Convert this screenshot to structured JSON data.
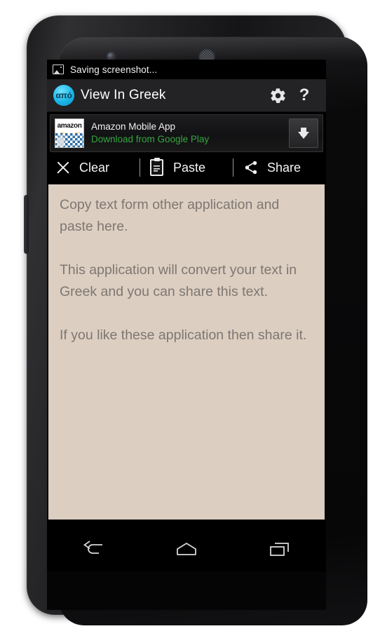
{
  "device": {
    "front_camera": "front-camera",
    "speaker": "earpiece-speaker",
    "volume_rocker": "volume-rocker"
  },
  "status_bar": {
    "icon": "photo-icon",
    "text": "Saving screenshot..."
  },
  "action_bar": {
    "logo_text": "από",
    "logo_icon": "app-logo-icon",
    "title": "View In Greek",
    "settings_icon": "gear-icon",
    "help_icon": "?",
    "background_color": "#232326"
  },
  "ad_banner": {
    "app_icon_word": "amazon",
    "title": "Amazon Mobile App",
    "subtitle": "Download from Google Play",
    "subtitle_color": "#35a63f",
    "download_icon": "download-arrow-icon"
  },
  "toolbar": {
    "buttons": [
      {
        "icon": "close-x-icon",
        "label": "Clear"
      },
      {
        "icon": "clipboard-icon",
        "label": "Paste"
      },
      {
        "icon": "share-icon",
        "label": "Share"
      }
    ]
  },
  "text_area": {
    "background_color": "#dccec1",
    "text_color": "#7e7771",
    "paragraphs": [
      "Copy text form other application and paste here.",
      "This application will convert your text in Greek and you can share this text.",
      "If you like these application then share it."
    ]
  },
  "nav_bar": {
    "buttons": [
      {
        "icon": "back-icon",
        "name": "nav-back"
      },
      {
        "icon": "home-icon",
        "name": "nav-home"
      },
      {
        "icon": "recents-icon",
        "name": "nav-recents"
      }
    ]
  }
}
